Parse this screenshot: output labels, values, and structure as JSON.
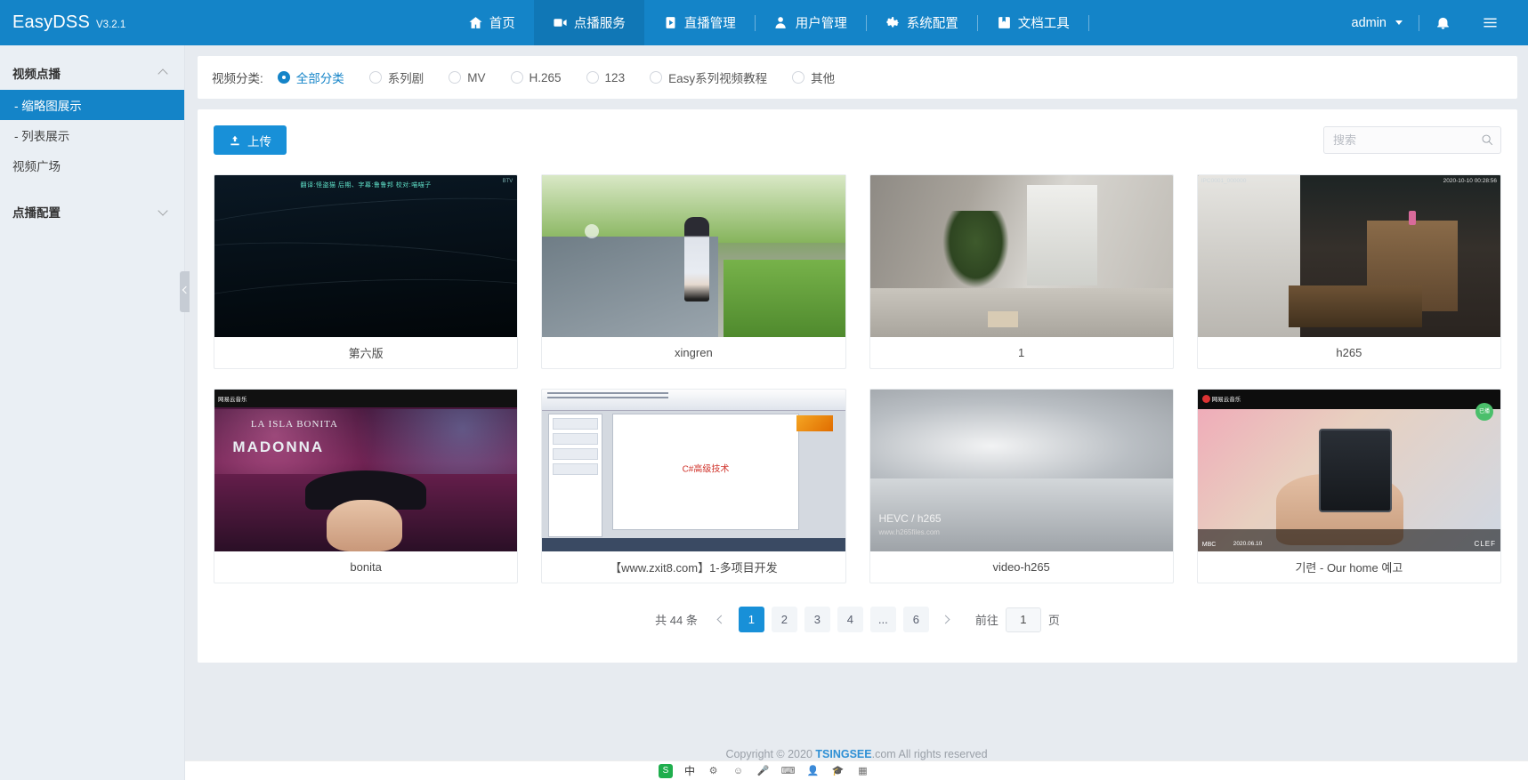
{
  "brand": {
    "name": "EasyDSS",
    "version": "V3.2.1"
  },
  "nav": {
    "items": [
      {
        "label": "首页",
        "icon": "home-icon",
        "active": false
      },
      {
        "label": "点播服务",
        "icon": "video-on-demand-icon",
        "active": true
      },
      {
        "label": "直播管理",
        "icon": "live-broadcast-icon",
        "active": false
      },
      {
        "label": "用户管理",
        "icon": "user-icon",
        "active": false
      },
      {
        "label": "系统配置",
        "icon": "gear-icon",
        "active": false
      },
      {
        "label": "文档工具",
        "icon": "book-icon",
        "active": false
      }
    ],
    "user": "admin",
    "bell": "bell-icon",
    "menu": "hamburger-icon"
  },
  "sidebar": {
    "groups": [
      {
        "label": "视频点播",
        "expanded": true,
        "items": [
          {
            "label": "- 缩略图展示",
            "selected": true
          },
          {
            "label": "- 列表展示",
            "selected": false
          },
          {
            "label": "视频广场",
            "selected": false
          }
        ]
      },
      {
        "label": "点播配置",
        "expanded": false,
        "items": []
      }
    ]
  },
  "filter": {
    "label": "视频分类:",
    "options": [
      {
        "label": "全部分类",
        "selected": true
      },
      {
        "label": "系列剧",
        "selected": false
      },
      {
        "label": "MV",
        "selected": false
      },
      {
        "label": "H.265",
        "selected": false
      },
      {
        "label": "123",
        "selected": false
      },
      {
        "label": "Easy系列视频教程",
        "selected": false
      },
      {
        "label": "其他",
        "selected": false
      }
    ]
  },
  "toolbar": {
    "upload_label": "上传",
    "upload_icon": "upload-icon",
    "search_placeholder": "搜索",
    "search_value": "",
    "search_icon": "search-icon"
  },
  "videos": [
    {
      "title": "第六版",
      "art": "t-anime",
      "overlay_sub": "翻译:怪盗猫       后期、字幕:鲁鲁邦       校对:喵喵子",
      "overlay_tag": "BTV"
    },
    {
      "title": "xingren",
      "art": "t-girl"
    },
    {
      "title": "1",
      "art": "t-room",
      "overlay_tag": ""
    },
    {
      "title": "h265",
      "art": "t-ipc",
      "overlay_left": "IPC0001_000000",
      "overlay_right": "2020-10-10  00:28:56"
    },
    {
      "title": "bonita",
      "art": "t-madonna",
      "overlay_header": "网易云音乐",
      "overlay_title": "LA ISLA BONITA",
      "overlay_big": "MADONNA"
    },
    {
      "title": "【www.zxit8.com】1-多项目开发",
      "art": "t-ppt",
      "slide_text": "C#高级技术"
    },
    {
      "title": "video-h265",
      "art": "t-hevc",
      "overlay_t1": "HEVC / h265",
      "overlay_t2": "www.h265files.com"
    },
    {
      "title": "기련 - Our home 예고",
      "art": "t-kpop",
      "overlay_header": "网易云音乐",
      "overlay_badge": "已播",
      "overlay_left": "MBC",
      "overlay_date": "2020.06.10",
      "overlay_right": "CLEF"
    }
  ],
  "pagination": {
    "total_text": "共 44 条",
    "pages": [
      "1",
      "2",
      "3",
      "4",
      "...",
      "6"
    ],
    "current": "1",
    "jump_prefix": "前往",
    "jump_value": "1",
    "jump_suffix": "页"
  },
  "footer": {
    "text_before": "Copyright © 2020 ",
    "brand": "TSINGSEE",
    "text_after": ".com All rights reserved"
  },
  "ime": {
    "logo": "S",
    "mode": "中",
    "items": [
      "settings-icon",
      "emoji-icon",
      "mic-icon",
      "keyboard-icon",
      "user-icon",
      "graduation-icon",
      "apps-icon"
    ]
  },
  "colors": {
    "accent": "#1484c8",
    "accent_button": "#1890d8",
    "sidebar_bg": "#eaeff4"
  }
}
